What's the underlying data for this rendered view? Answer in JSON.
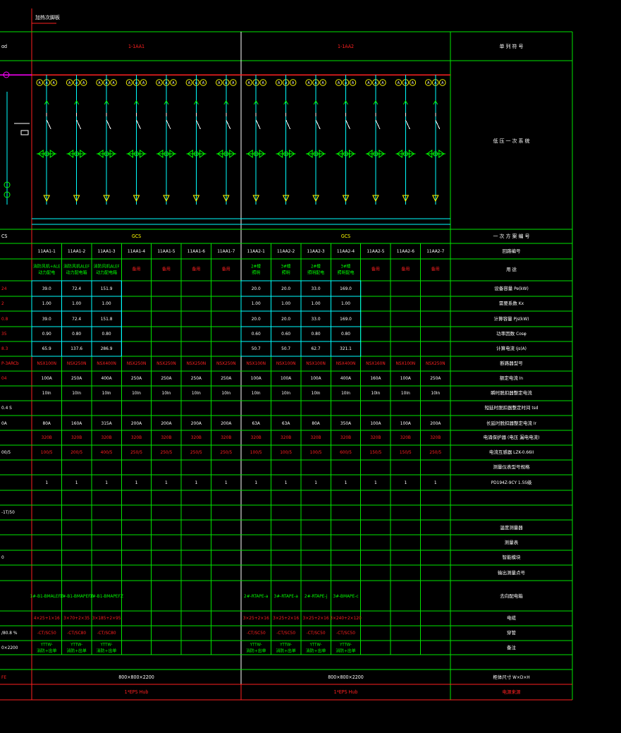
{
  "drawing_title": "加热次脚板",
  "panels": [
    {
      "name": "1-1AA1"
    },
    {
      "name": "1-1AA2"
    }
  ],
  "header_right": "单 列 符 号",
  "schematic_label": "低 压 一 次 系 统",
  "cabinet_type_row": {
    "left_cut": "CS",
    "panel1": "GCS",
    "panel2": "GCS",
    "label": "一 次 方 案 编 号"
  },
  "left_edge_top": "ɑd",
  "left_edge_values": [
    "CS",
    "",
    "",
    "24",
    "2",
    "0.8",
    "35",
    "8.3",
    "P-3ARCb",
    "04",
    "",
    "0.4 S",
    "0A",
    "",
    "00/5",
    "",
    "",
    "",
    "-1T/50",
    "",
    "",
    "0",
    "",
    "",
    "",
    "/80.8 %",
    "0×2200",
    "FE"
  ],
  "circuits": [
    "11AA1-1",
    "11AA1-2",
    "11AA1-3",
    "11AA1-4",
    "11AA1-5",
    "11AA1-6",
    "11AA1-7",
    "11AA2-1",
    "11AA2-2",
    "11AA2-3",
    "11AA2-4",
    "11AA2-5",
    "11AA2-6",
    "11AA2-7"
  ],
  "rows": [
    {
      "label": "回路编号",
      "cells": [
        "11AA1-1",
        "11AA1-2",
        "11AA1-3",
        "11AA1-4",
        "11AA1-5",
        "11AA1-6",
        "11AA1-7",
        "11AA2-1",
        "11AA2-2",
        "11AA2-3",
        "11AA2-4",
        "11AA2-5",
        "11AA2-6",
        "11AA2-7"
      ]
    },
    {
      "label": "用 途",
      "cells": [
        "消防风机+ALE\n动力配电",
        "消防风机ALEF\n动力配电箱",
        "消防风机ALEF\n动力配电箱",
        "备用",
        "备用",
        "备用",
        "备用",
        "2#楼\n照明",
        "3#楼\n照明",
        "2#楼\n照明配电",
        "3#楼\n照明配电",
        "备用",
        "备用",
        "备用"
      ]
    },
    {
      "label": "设备容量 Pe(kW)",
      "cells": [
        "39.0",
        "72.4",
        "151.9",
        "",
        "",
        "",
        "",
        "20.0",
        "20.0",
        "33.0",
        "169.0",
        "",
        "",
        ""
      ]
    },
    {
      "label": "需要系数 Kx",
      "cells": [
        "1.00",
        "1.00",
        "1.00",
        "",
        "",
        "",
        "",
        "1.00",
        "1.00",
        "1.00",
        "1.00",
        "",
        "",
        ""
      ]
    },
    {
      "label": "计算容量 Pjs(kW)",
      "cells": [
        "39.0",
        "72.4",
        "151.8",
        "",
        "",
        "",
        "",
        "20.0",
        "20.0",
        "33.0",
        "169.0",
        "",
        "",
        ""
      ]
    },
    {
      "label": "功率因数 Cosφ",
      "cells": [
        "0.90",
        "0.80",
        "0.80",
        "",
        "",
        "",
        "",
        "0.60",
        "0.60",
        "0.80",
        "0.80",
        "",
        "",
        ""
      ]
    },
    {
      "label": "计算电流 Ijs(A)",
      "cells": [
        "65.9",
        "137.6",
        "286.9",
        "",
        "",
        "",
        "",
        "50.7",
        "50.7",
        "62.7",
        "321.1",
        "",
        "",
        ""
      ]
    },
    {
      "label": "断路器型号",
      "cells": [
        "NSX100N",
        "NSX250N",
        "NSX400N",
        "NSX250N",
        "NSX250N",
        "NSX250N",
        "NSX250N",
        "NSX100N",
        "NSX100N",
        "NSX100N",
        "NSX400N",
        "NSX160N",
        "NSX100N",
        "NSX250N"
      ]
    },
    {
      "label": "额定电流 In",
      "cells": [
        "100A",
        "250A",
        "400A",
        "250A",
        "250A",
        "250A",
        "250A",
        "100A",
        "100A",
        "100A",
        "400A",
        "160A",
        "100A",
        "250A"
      ]
    },
    {
      "label": "瞬时脱扣器整定电流",
      "cells": [
        "10In",
        "10In",
        "10In",
        "10In",
        "10In",
        "10In",
        "10In",
        "10In",
        "10In",
        "10In",
        "10In",
        "10In",
        "10In",
        "10In"
      ]
    },
    {
      "label": "短延时脱扣器整定时间 tsd",
      "cells": [
        "",
        "",
        "",
        "",
        "",
        "",
        "",
        "",
        "",
        "",
        "",
        "",
        "",
        ""
      ]
    },
    {
      "label": "长延时脱扣器整定电流 Ir",
      "cells": [
        "80A",
        "160A",
        "315A",
        "200A",
        "200A",
        "200A",
        "200A",
        "63A",
        "63A",
        "80A",
        "350A",
        "100A",
        "100A",
        "200A"
      ]
    },
    {
      "label": "电涌保护器 (电压 漏电电流)",
      "cells": [
        "320B",
        "320B",
        "320B",
        "320B",
        "320B",
        "320B",
        "320B",
        "320B",
        "320B",
        "320B",
        "320B",
        "320B",
        "320B",
        "320B"
      ]
    },
    {
      "label": "电流互感器 LZK-0.66II",
      "cells": [
        "100/5",
        "200/5",
        "400/5",
        "250/5",
        "250/5",
        "250/5",
        "250/5",
        "100/5",
        "100/5",
        "100/5",
        "600/5",
        "150/5",
        "150/5",
        "250/5"
      ]
    },
    {
      "label": "测量仪表型号规格",
      "cells": [
        "",
        "",
        "",
        "",
        "",
        "",
        "",
        "",
        "",
        "",
        "",
        "",
        "",
        ""
      ]
    },
    {
      "label": "PD194Z-9CY 1.5S级",
      "cells": [
        "1",
        "1",
        "1",
        "1",
        "1",
        "1",
        "1",
        "1",
        "1",
        "1",
        "1",
        "1",
        "1",
        "1"
      ]
    },
    {
      "label": "",
      "cells": [
        "",
        "",
        "",
        "",
        "",
        "",
        "",
        "",
        "",
        "",
        "",
        "",
        "",
        ""
      ]
    },
    {
      "label": "",
      "cells": [
        "",
        "",
        "",
        "",
        "",
        "",
        "",
        "",
        "",
        "",
        "",
        "",
        "",
        ""
      ]
    },
    {
      "label": "温度测量器",
      "cells": [
        "",
        "",
        "",
        "",
        "",
        "",
        "",
        "",
        "",
        "",
        "",
        "",
        "",
        ""
      ]
    },
    {
      "label": "测量表",
      "cells": [
        "",
        "",
        "",
        "",
        "",
        "",
        "",
        "",
        "",
        "",
        "",
        "",
        "",
        ""
      ]
    },
    {
      "label": "智能模块",
      "cells": [
        "",
        "",
        "",
        "",
        "",
        "",
        "",
        "",
        "",
        "",
        "",
        "",
        "",
        ""
      ]
    },
    {
      "label": "输出测量点号",
      "cells": [
        "",
        "",
        "",
        "",
        "",
        "",
        "",
        "",
        "",
        "",
        "",
        "",
        "",
        ""
      ]
    },
    {
      "label": "去向配电箱",
      "cells": [
        "1#-B1-BMALEFZ",
        "1#-B1-BMAPEFZ",
        "1#-B1-BMAPEFZ",
        "",
        "",
        "",
        "",
        "2#-RTAPE-a",
        "3#-RTAPE-a",
        "2#-RTAPE-j",
        "3#-BMAPE-c",
        "",
        "",
        ""
      ]
    },
    {
      "label": "电缆",
      "cells": [
        "4×25+1×16",
        "3×70+2×35",
        "3×185+2×95",
        "",
        "",
        "",
        "",
        "3×25+2×16",
        "3×25+2×16",
        "3×25+2×16",
        "3×240+2×120",
        "",
        "",
        ""
      ]
    },
    {
      "label": "穿管",
      "cells": [
        "-CT/SC50",
        "-CT/SC80",
        "-CT/SC80",
        "",
        "",
        "",
        "",
        "-CT/SC50",
        "-CT/SC50",
        "-CT/SC50",
        "-CT/SC50",
        "",
        "",
        ""
      ]
    },
    {
      "label": "备注",
      "cells": [
        "YTTW-\n消防+出单",
        "YTTW-\n消防+出单",
        "YTTW-\n消防+出单",
        "",
        "",
        "",
        "",
        "YTTW-\n消防+出单",
        "YTTW-\n消防+出单",
        "YTTW-\n消防+出单",
        "YTTW-\n消防+出单",
        "",
        "",
        ""
      ]
    }
  ],
  "size_row": {
    "label": "柜体尺寸 W×D×H",
    "panel1": "800×800×2200",
    "panel2": "800×800×2200"
  },
  "source_row": {
    "label": "电源来源",
    "panel1": "1*EPS Hub",
    "panel2": "1*EPS Hub"
  },
  "meter_symbol": "A",
  "colors": {
    "grid": "#00e600",
    "red": "#ff2020",
    "white": "#ffffff",
    "yellow": "#ffff00",
    "cyan": "#00ffff",
    "green": "#00ff00",
    "magenta": "#ff00ff"
  }
}
